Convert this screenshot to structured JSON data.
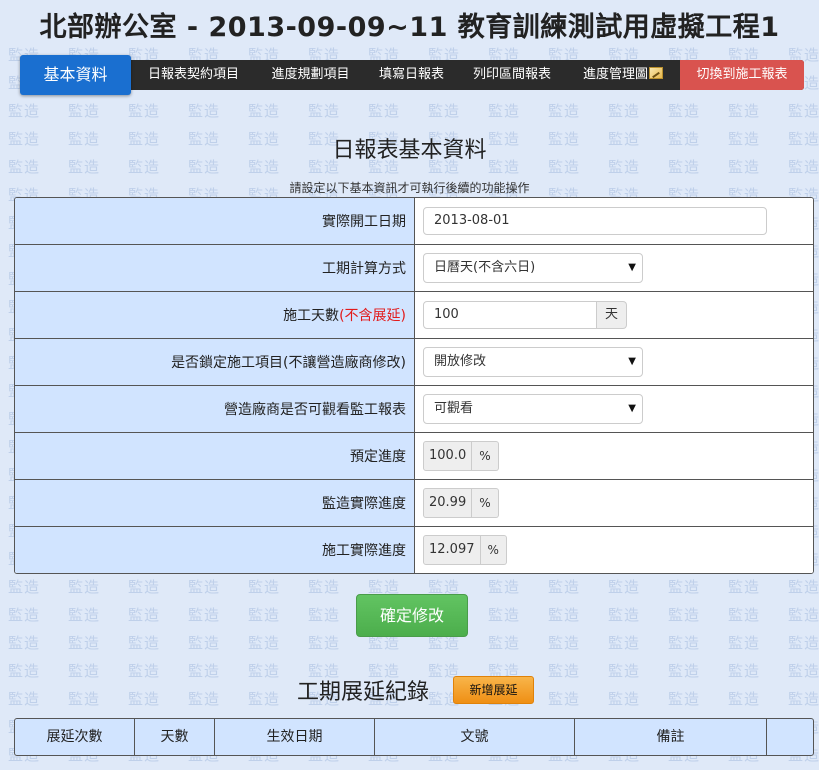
{
  "title": "北部辦公室 - 2013-09-09~11 教育訓練測試用虛擬工程1",
  "watermark": "監造",
  "nav": {
    "items": [
      {
        "label": "基本資料",
        "active": true
      },
      {
        "label": "日報表契約項目"
      },
      {
        "label": "進度規劃項目"
      },
      {
        "label": "填寫日報表"
      },
      {
        "label": "列印區間報表"
      },
      {
        "label": "進度管理圖",
        "icon": "chart-icon"
      },
      {
        "label": "切換到施工報表",
        "danger": true
      }
    ]
  },
  "section": {
    "title": "日報表基本資料",
    "hint": "請設定以下基本資訊才可執行後續的功能操作"
  },
  "form": {
    "actual_start_label": "實際開工日期",
    "actual_start_value": "2013-08-01",
    "calc_method_label": "工期計算方式",
    "calc_method_value": "日曆天(不含六日)",
    "work_days_label": "施工天數",
    "work_days_note": "(不含展延)",
    "work_days_value": "100",
    "work_days_unit": "天",
    "lock_items_label": "是否鎖定施工項目(不讓營造廠商修改)",
    "lock_items_value": "開放修改",
    "contractor_view_label": "營造廠商是否可觀看監工報表",
    "contractor_view_value": "可觀看",
    "planned_progress_label": "預定進度",
    "planned_progress_value": "100.0",
    "supervision_progress_label": "監造實際進度",
    "supervision_progress_value": "20.99",
    "construction_progress_label": "施工實際進度",
    "construction_progress_value": "12.097",
    "percent": "%"
  },
  "confirm_label": "確定修改",
  "extension": {
    "title": "工期展延紀錄",
    "add_label": "新增展延",
    "columns": [
      "展延次數",
      "天數",
      "生效日期",
      "文號",
      "備註",
      ""
    ]
  },
  "colors": {
    "nav_active": "#1a6fd0",
    "nav_danger": "#d9534f",
    "confirm": "#5cb85c",
    "add_button": "#f0a030",
    "label_bg": "#d1e4ff"
  }
}
